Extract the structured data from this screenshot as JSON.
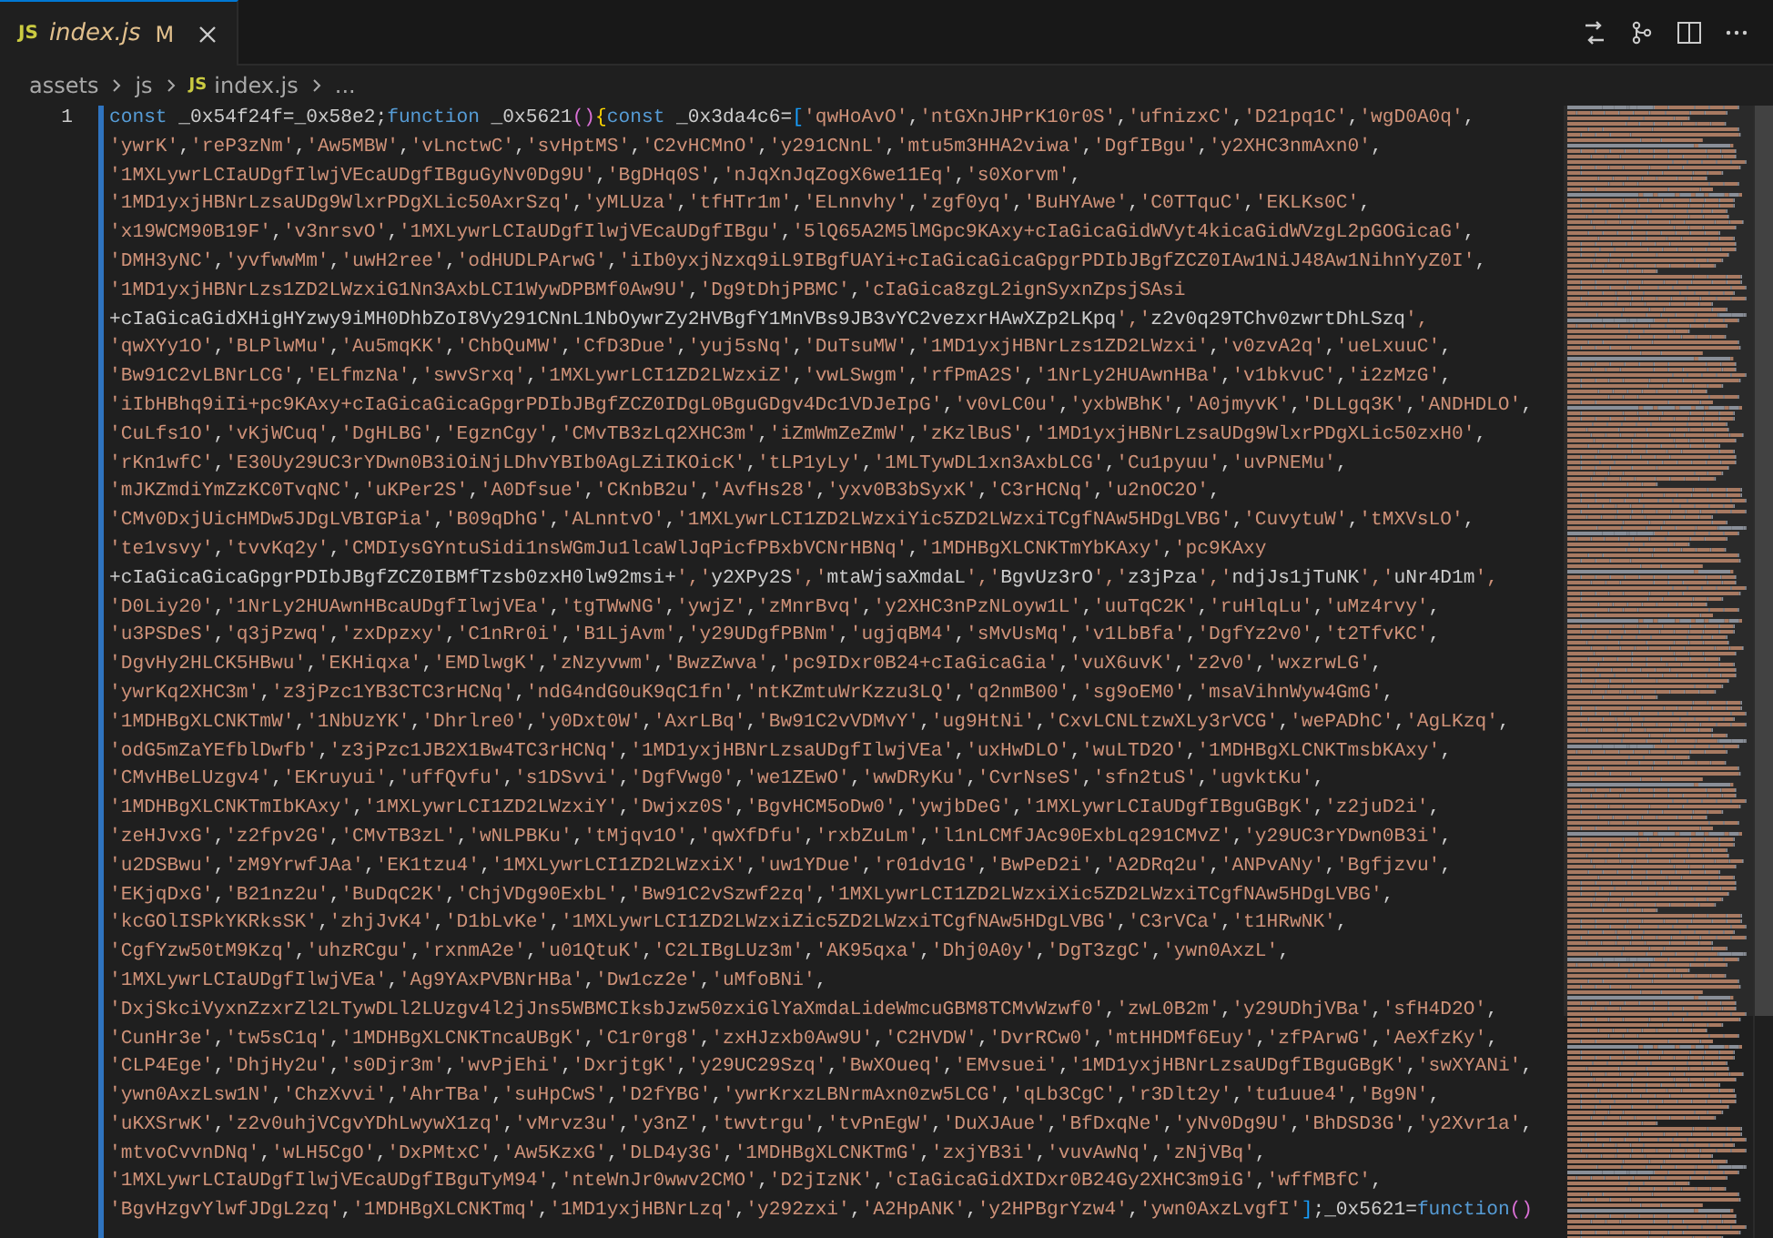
{
  "tab": {
    "file_icon": "JS",
    "label": "index.js",
    "status": "M",
    "selected": true
  },
  "breadcrumbs": [
    {
      "label": "assets"
    },
    {
      "label": "js"
    },
    {
      "label": "index.js",
      "file_icon": "JS"
    },
    {
      "label": "..."
    }
  ],
  "editor": {
    "line_number": "1",
    "modified": true,
    "lines": [
      "const _0x54f24f=_0x58e2;function _0x5621(){const _0x3da4c6=['qwHoAvO','ntGXnJHPrK10r0S','ufnizxC','D21pq1C','wgD0A0q',",
      "'ywrK','reP3zNm','Aw5MBW','vLnctwC','svHptMS','C2vHCMnO','y291CNnL','mtu5m3HHA2viwa','DgfIBgu','y2XHC3nmAxn0',",
      "'1MXLywrLCIaUDgfIlwjVEcaUDgfIBguGyNv0Dg9U','BgDHq0S','nJqXnJqZogX6we11Eq','s0Xorvm',",
      "'1MD1yxjHBNrLzsaUDg9WlxrPDgXLic50AxrSzq','yMLUza','tfHTr1m','ELnnvhy','zgf0yq','BuHYAwe','C0TTquC','EKLKs0C',",
      "'x19WCM90B19F','v3nrsvO','1MXLywrLCIaUDgfIlwjVEcaUDgfIBgu','5lQ65A2M5lMGpc9KAxy+cIaGicaGidWVyt4kicaGidWVzgL2pGOGicaG',",
      "'DMH3yNC','yvfwwMm','uwH2ree','odHUDLPArwG','iIb0yxjNzxq9iL9IBgfUAYi+cIaGicaGicaGpgrPDIbJBgfZCZ0IAw1NiJ48Aw1NihnYyZ0I',",
      "'1MD1yxjHBNrLzs1ZD2LWzxiG1Nn3AxbLCI1WywDPBMf0Aw9U','Dg9tDhjPBMC','cIaGica8zgL2ignSyxnZpsjSAsi",
      "+cIaGicaGidXHigHYzwy9iMH0DhbZoI8Vy291CNnL1NbOywrZy2HVBgfY1MnVBs9JB3vYC2vezxrHAwXZp2LKpq','z2v0q29TChv0zwrtDhLSzq',",
      "'qwXYy1O','BLPlwMu','Au5mqKK','ChbQuMW','CfD3Due','yuj5sNq','DuTsuMW','1MD1yxjHBNrLzs1ZD2LWzxi','v0zvA2q','ueLxuuC',",
      "'Bw91C2vLBNrLCG','ELfmzNa','swvSrxq','1MXLywrLCI1ZD2LWzxiZ','vwLSwgm','rfPmA2S','1NrLy2HUAwnHBa','v1bkvuC','i2zMzG',",
      "'iIbHBhq9iIi+pc9KAxy+cIaGicaGicaGpgrPDIbJBgfZCZ0IDgL0BguGDgv4Dc1VDJeIpG','v0vLC0u','yxbWBhK','A0jmyvK','DLLgq3K','ANDHDLO',",
      "'CuLfs1O','vKjWCuq','DgHLBG','EgznCgy','CMvTB3zLq2XHC3m','iZmWmZeZmW','zKzlBuS','1MD1yxjHBNrLzsaUDg9WlxrPDgXLic50zxH0',",
      "'rKn1wfC','E30Uy29UC3rYDwn0B3iOiNjLDhvYBIb0AgLZiIKOicK','tLP1yLy','1MLTywDL1xn3AxbLCG','Cu1pyuu','uvPNEMu',",
      "'mJKZmdiYmZzKC0TvqNC','uKPer2S','A0Dfsue','CKnbB2u','AvfHs28','yxv0B3bSyxK','C3rHCNq','u2nOC2O',",
      "'CMv0DxjUicHMDw5JDgLVBIGPia','B09qDhG','ALnntvO','1MXLywrLCI1ZD2LWzxiYic5ZD2LWzxiTCgfNAw5HDgLVBG','CuvytuW','tMXVsLO',",
      "'te1vsvy','tvvKq2y','CMDIysGYntuSidi1nsWGmJu1lcaWlJqPicfPBxbVCNrHBNq','1MDHBgXLCNKTmYbKAxy','pc9KAxy",
      "+cIaGicaGicaGpgrPDIbJBgfZCZ0IBMfTzsb0zxH0lw92msi+','y2XPy2S','mtaWjsaXmdaL','BgvUz3rO','z3jPza','ndjJs1jTuNK','uNr4D1m',",
      "'D0Liy20','1NrLy2HUAwnHBcaUDgfIlwjVEa','tgTWwNG','ywjZ','zMnrBvq','y2XHC3nPzNLoyw1L','uuTqC2K','ruHlqLu','uMz4rvy',",
      "'u3PSDeS','q3jPzwq','zxDpzxy','C1nRr0i','B1LjAvm','y29UDgfPBNm','ugjqBM4','sMvUsMq','v1LbBfa','DgfYz2v0','t2TfvKC',",
      "'DgvHy2HLCK5HBwu','EKHiqxa','EMDlwgK','zNzyvwm','BwzZwva','pc9IDxr0B24+cIaGicaGia','vuX6uvK','z2v0','wxzrwLG',",
      "'ywrKq2XHC3m','z3jPzc1YB3CTC3rHCNq','ndG4ndG0uK9qC1fn','ntKZmtuWrKzzu3LQ','q2nmB00','sg9oEM0','msaVihnWyw4GmG',",
      "'1MDHBgXLCNKTmW','1NbUzYK','Dhrlre0','y0Dxt0W','AxrLBq','Bw91C2vVDMvY','ug9HtNi','CxvLCNLtzwXLy3rVCG','wePADhC','AgLKzq',",
      "'odG5mZaYEfblDwfb','z3jPzc1JB2X1Bw4TC3rHCNq','1MD1yxjHBNrLzsaUDgfIlwjVEa','uxHwDLO','wuLTD2O','1MDHBgXLCNKTmsbKAxy',",
      "'CMvHBeLUzgv4','EKruyui','uffQvfu','s1DSvvi','DgfVwg0','we1ZEwO','wwDRyKu','CvrNseS','sfn2tuS','ugvktKu',",
      "'1MDHBgXLCNKTmIbKAxy','1MXLywrLCI1ZD2LWzxiY','Dwjxz0S','BgvHCM5oDw0','ywjbDeG','1MXLywrLCIaUDgfIBguGBgK','z2juD2i',",
      "'zeHJvxG','z2fpv2G','CMvTB3zL','wNLPBKu','tMjqv1O','qwXfDfu','rxbZuLm','l1nLCMfJAc90ExbLq291CMvZ','y29UC3rYDwn0B3i',",
      "'u2DSBwu','zM9YrwfJAa','EK1tzu4','1MXLywrLCI1ZD2LWzxiX','uw1YDue','r01dv1G','BwPeD2i','A2DRq2u','ANPvANy','Bgfjzvu',",
      "'EKjqDxG','B21nz2u','BuDqC2K','ChjVDg90ExbL','Bw91C2vSzwf2zq','1MXLywrLCI1ZD2LWzxiXic5ZD2LWzxiTCgfNAw5HDgLVBG',",
      "'kcGOlISPkYKRksSK','zhjJvK4','D1bLvKe','1MXLywrLCI1ZD2LWzxiZic5ZD2LWzxiTCgfNAw5HDgLVBG','C3rVCa','t1HRwNK',",
      "'CgfYzw50tM9Kzq','uhzRCgu','rxnmA2e','u01QtuK','C2LIBgLUz3m','AK95qxa','Dhj0A0y','DgT3zgC','ywn0AxzL',",
      "'1MXLywrLCIaUDgfIlwjVEa','Ag9YAxPVBNrHBa','Dw1cz2e','uMfoBNi',",
      "'DxjSkciVyxnZzxrZl2LTywDLl2LUzgv4l2jJns5WBMCIksbJzw50zxiGlYaXmdaLideWmcuGBM8TCMvWzwf0','zwL0B2m','y29UDhjVBa','sfH4D2O',",
      "'CunHr3e','tw5sC1q','1MDHBgXLCNKTncaUBgK','C1r0rg8','zxHJzxb0Aw9U','C2HVDW','DvrRCw0','mtHHDMf6Euy','zfPArwG','AeXfzKy',",
      "'CLP4Ege','DhjHy2u','s0Djr3m','wvPjEhi','DxrjtgK','y29UC29Szq','BwXOueq','EMvsuei','1MD1yxjHBNrLzsaUDgfIBguGBgK','swXYANi',",
      "'ywn0AxzLsw1N','ChzXvvi','AhrTBa','suHpCwS','D2fYBG','ywrKrxzLBNrmAxn0zw5LCG','qLb3CgC','r3Dlt2y','tu1uue4','Bg9N',",
      "'uKXSrwK','z2v0uhjVCgvYDhLwywX1zq','vMrvz3u','y3nZ','twvtrgu','tvPnEgW','DuXJAue','BfDxqNe','yNv0Dg9U','BhDSD3G','y2Xvr1a',",
      "'mtvoCvvnDNq','wLH5CgO','DxPMtxC','Aw5KzxG','DLD4y3G','1MDHBgXLCNKTmG','zxjYB3i','vuvAwNq','zNjVBq',",
      "'1MXLywrLCIaUDgfIlwjVEcaUDgfIBguTyM94','nteWnJr0wwv2CMO','D2jIzNK','cIaGicaGidXIDxr0B24Gy2XHC3m9iG','wffMBfC',",
      "'BgvHzgvYlwfJDgL2zq','1MDHBgXLCNKTmq','1MD1yxjHBNrLzq','y292zxi','A2HpANK','y2HPBgrYzw4','ywn0AxzLvgfI'];_0x5621=function()"
    ]
  }
}
